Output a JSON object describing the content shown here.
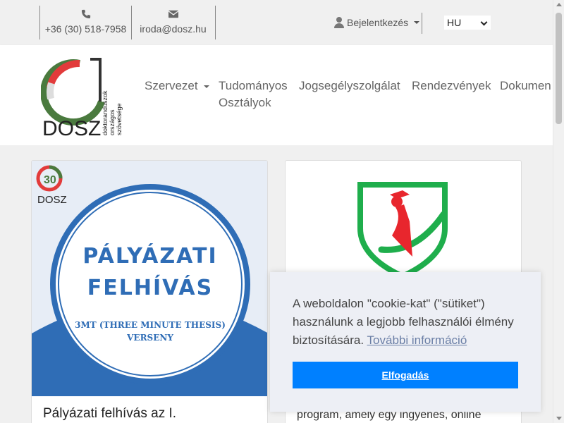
{
  "topbar": {
    "phone": "+36 (30) 518-7958",
    "email": "iroda@dosz.hu",
    "login_label": "Bejelentkezés",
    "language": "HU"
  },
  "logo": {
    "text": "DOSZ",
    "tagline": [
      "doktoranduszok",
      "országos",
      "szövetsége"
    ]
  },
  "nav": {
    "items": [
      "Szervezet",
      "Tudományos",
      "Osztályok",
      "Jogsegélyszolgálat",
      "Rendezvények",
      "Dokumen"
    ]
  },
  "cards": [
    {
      "hero_title_1": "PÁLYÁZATI",
      "hero_title_2": "FELHÍVÁS",
      "hero_sub_1": "3MT (THREE MINUTE THESIS)",
      "hero_sub_2": "VERSENY",
      "hero_logo": "DOSZ",
      "hero_badge": "30",
      "title": "Pályázati felhívás az I."
    },
    {
      "text": "program, amely egy ingyenes, online"
    }
  ],
  "cookie": {
    "message": "A weboldalon \"cookie-kat\" (\"sütiket\") használunk a legjobb felhasználói élmény biztosítására.",
    "link": "További információ",
    "accept": "Elfogadás"
  },
  "colors": {
    "accent": "#0080ff",
    "logo_red": "#e23b3b",
    "logo_green": "#4a7a3e",
    "hero_blue": "#2f6db6",
    "shield_green": "#1fae4c",
    "shield_red": "#e8262d"
  }
}
